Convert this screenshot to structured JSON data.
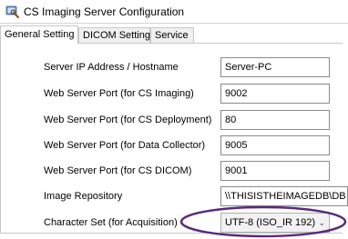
{
  "window": {
    "title": "CS Imaging Server Configuration",
    "icon": "wrench-icon"
  },
  "tabs": [
    {
      "label": "General Setting",
      "active": true
    },
    {
      "label": "DICOM Setting",
      "active": false
    },
    {
      "label": "Service",
      "active": false
    }
  ],
  "form": {
    "server_ip": {
      "label": "Server IP Address / Hostname",
      "value": "Server-PC"
    },
    "web_port_imaging": {
      "label": "Web Server Port (for CS Imaging)",
      "value": "9002"
    },
    "web_port_deployment": {
      "label": "Web Server Port (for CS Deployment)",
      "value": "80"
    },
    "web_port_collector": {
      "label": "Web Server Port (for Data Collector)",
      "value": "9005"
    },
    "web_port_dicom": {
      "label": "Web Server Port (for CS DICOM)",
      "value": "9001"
    },
    "image_repository": {
      "label": "Image Repository",
      "value": "\\\\THISISTHEIMAGEDB\\DB"
    },
    "character_set": {
      "label": "Character Set (for Acquisition)",
      "value": "UTF-8 (ISO_IR 192)"
    }
  },
  "colors": {
    "annotation": "#5a2a7a"
  }
}
